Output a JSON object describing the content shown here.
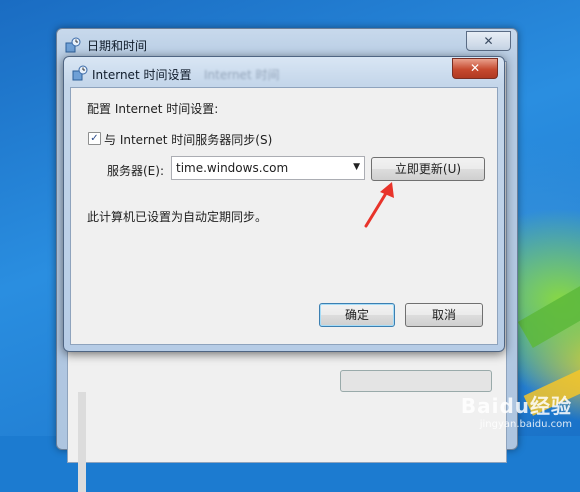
{
  "parent_window": {
    "title": "日期和时间",
    "close_glyph": "✕"
  },
  "dialog": {
    "title": "Internet 时间设置",
    "title_blur": "Internet 时间",
    "close_glyph": "✕",
    "heading": "配置 Internet 时间设置:",
    "sync_checkbox": {
      "checked": true,
      "mark": "✓",
      "label": "与 Internet 时间服务器同步(S)"
    },
    "server_label": "服务器(E):",
    "server_value": "time.windows.com",
    "dropdown_glyph": "▼",
    "update_button": "立即更新(U)",
    "status_text": "此计算机已设置为自动定期同步。",
    "ok_button": "确定",
    "cancel_button": "取消"
  },
  "watermark": {
    "main": "Baidu经验",
    "sub": "jingyan.baidu.com"
  },
  "colors": {
    "accent_arrow": "#e8332a",
    "close_red": "#c64a2f"
  },
  "icons": [
    "clock-globe-icon",
    "close-icon",
    "dropdown-arrow-icon",
    "checkmark-icon"
  ]
}
